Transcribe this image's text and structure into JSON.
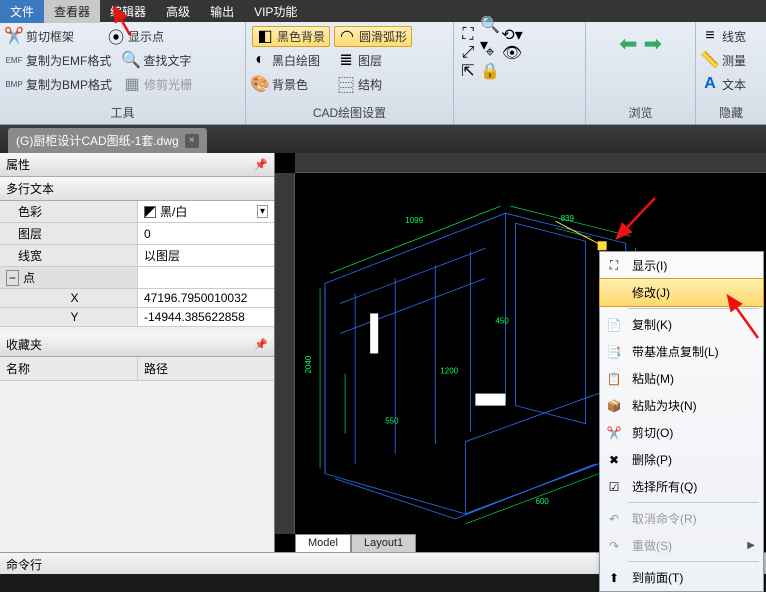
{
  "menu": {
    "file": "文件",
    "viewer": "查看器",
    "editor": "编辑器",
    "advanced": "高级",
    "output": "输出",
    "vip": "VIP功能"
  },
  "ribbon": {
    "tools": {
      "title": "工具",
      "clip": "剪切框架",
      "emf": "复制为EMF格式",
      "bmp": "复制为BMP格式",
      "showpoint": "显示点",
      "findtext": "查找文字",
      "trimhalo": "修剪光栅"
    },
    "cad": {
      "title": "CAD绘图设置",
      "blackbg": "黑色背景",
      "smootharc": "圆滑弧形",
      "bwdraw": "黑白绘图",
      "layer": "图层",
      "bgcolor": "背景色",
      "structure": "结构"
    },
    "browse": {
      "title": "浏览"
    },
    "hide": {
      "title": "隐藏",
      "linewidth": "线宽",
      "measure": "测量",
      "text": "文本"
    }
  },
  "tab": {
    "name": "(G)厨柜设计CAD图纸-1套.dwg"
  },
  "props": {
    "title": "属性",
    "type": "多行文本",
    "color_k": "色彩",
    "color_v": "黑/白",
    "layer_k": "图层",
    "layer_v": "0",
    "linew_k": "线宽",
    "linew_v": "以图层",
    "point": "点",
    "x_k": "X",
    "x_v": "47196.7950010032",
    "y_k": "Y",
    "y_v": "-14944.385622858"
  },
  "fav": {
    "title": "收藏夹",
    "name": "名称",
    "path": "路径"
  },
  "model": {
    "model": "Model",
    "layout1": "Layout1"
  },
  "cmd": {
    "title": "命令行"
  },
  "ctx": {
    "show": "显示(I)",
    "modify": "修改(J)",
    "copy": "复制(K)",
    "copybase": "带基准点复制(L)",
    "paste": "粘贴(M)",
    "pasteblock": "粘贴为块(N)",
    "cut": "剪切(O)",
    "delete": "删除(P)",
    "selectall": "选择所有(Q)",
    "undocmd": "取消命令(R)",
    "redo": "重做(S)",
    "front": "到前面(T)"
  }
}
